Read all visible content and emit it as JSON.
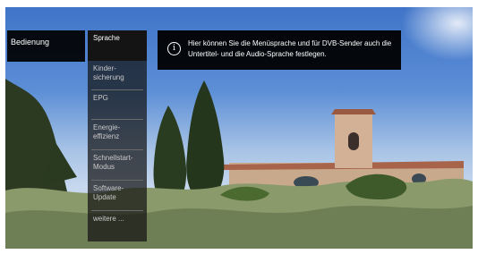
{
  "menu_left": {
    "label": "Bedienung"
  },
  "menu_items": [
    {
      "label": "Sprache"
    },
    {
      "label": "Kinder-\nsicherung"
    },
    {
      "label": "EPG"
    },
    {
      "label": "Energie-\neffizienz"
    },
    {
      "label": "Schnellstart-\nModus"
    },
    {
      "label": "Software-\nUpdate"
    },
    {
      "label": "weitere ..."
    }
  ],
  "info": {
    "icon": "info-icon",
    "text": "Hier können Sie die Menüsprache und für DVB-Sender auch die Untertitel- und die Audio-Sprache festlegen."
  },
  "colors": {
    "overlay": "#000000",
    "sky": "#4f84d0",
    "text": "#ffffff"
  }
}
